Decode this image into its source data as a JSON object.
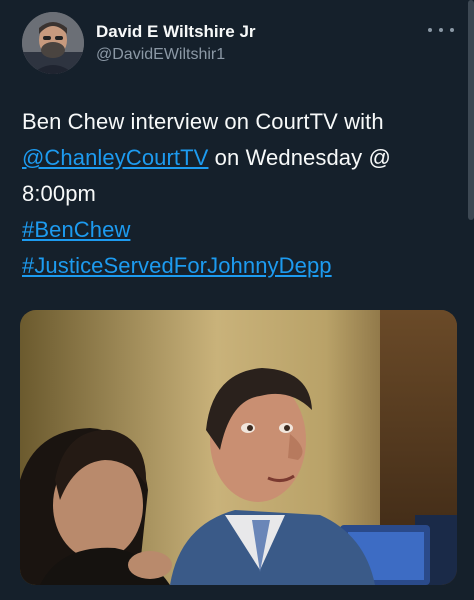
{
  "author": {
    "display_name": "David E Wiltshire Jr",
    "handle": "@DavidEWiltshir1",
    "avatar_icon": "profile-photo"
  },
  "tweet": {
    "line1": "Ben Chew interview on CourtTV with",
    "mention": "@ChanleyCourtTV",
    "line2_rest": " on Wednesday @",
    "line3": "8:00pm",
    "hashtag1": "#BenChew",
    "hashtag2": "#JusticeServedForJohnnyDepp"
  },
  "media": {
    "type": "photo"
  },
  "icons": {
    "more": "more-horizontal-icon"
  },
  "colors": {
    "background": "#15202b",
    "link": "#1d9bf0",
    "secondary_text": "#8b98a5"
  }
}
